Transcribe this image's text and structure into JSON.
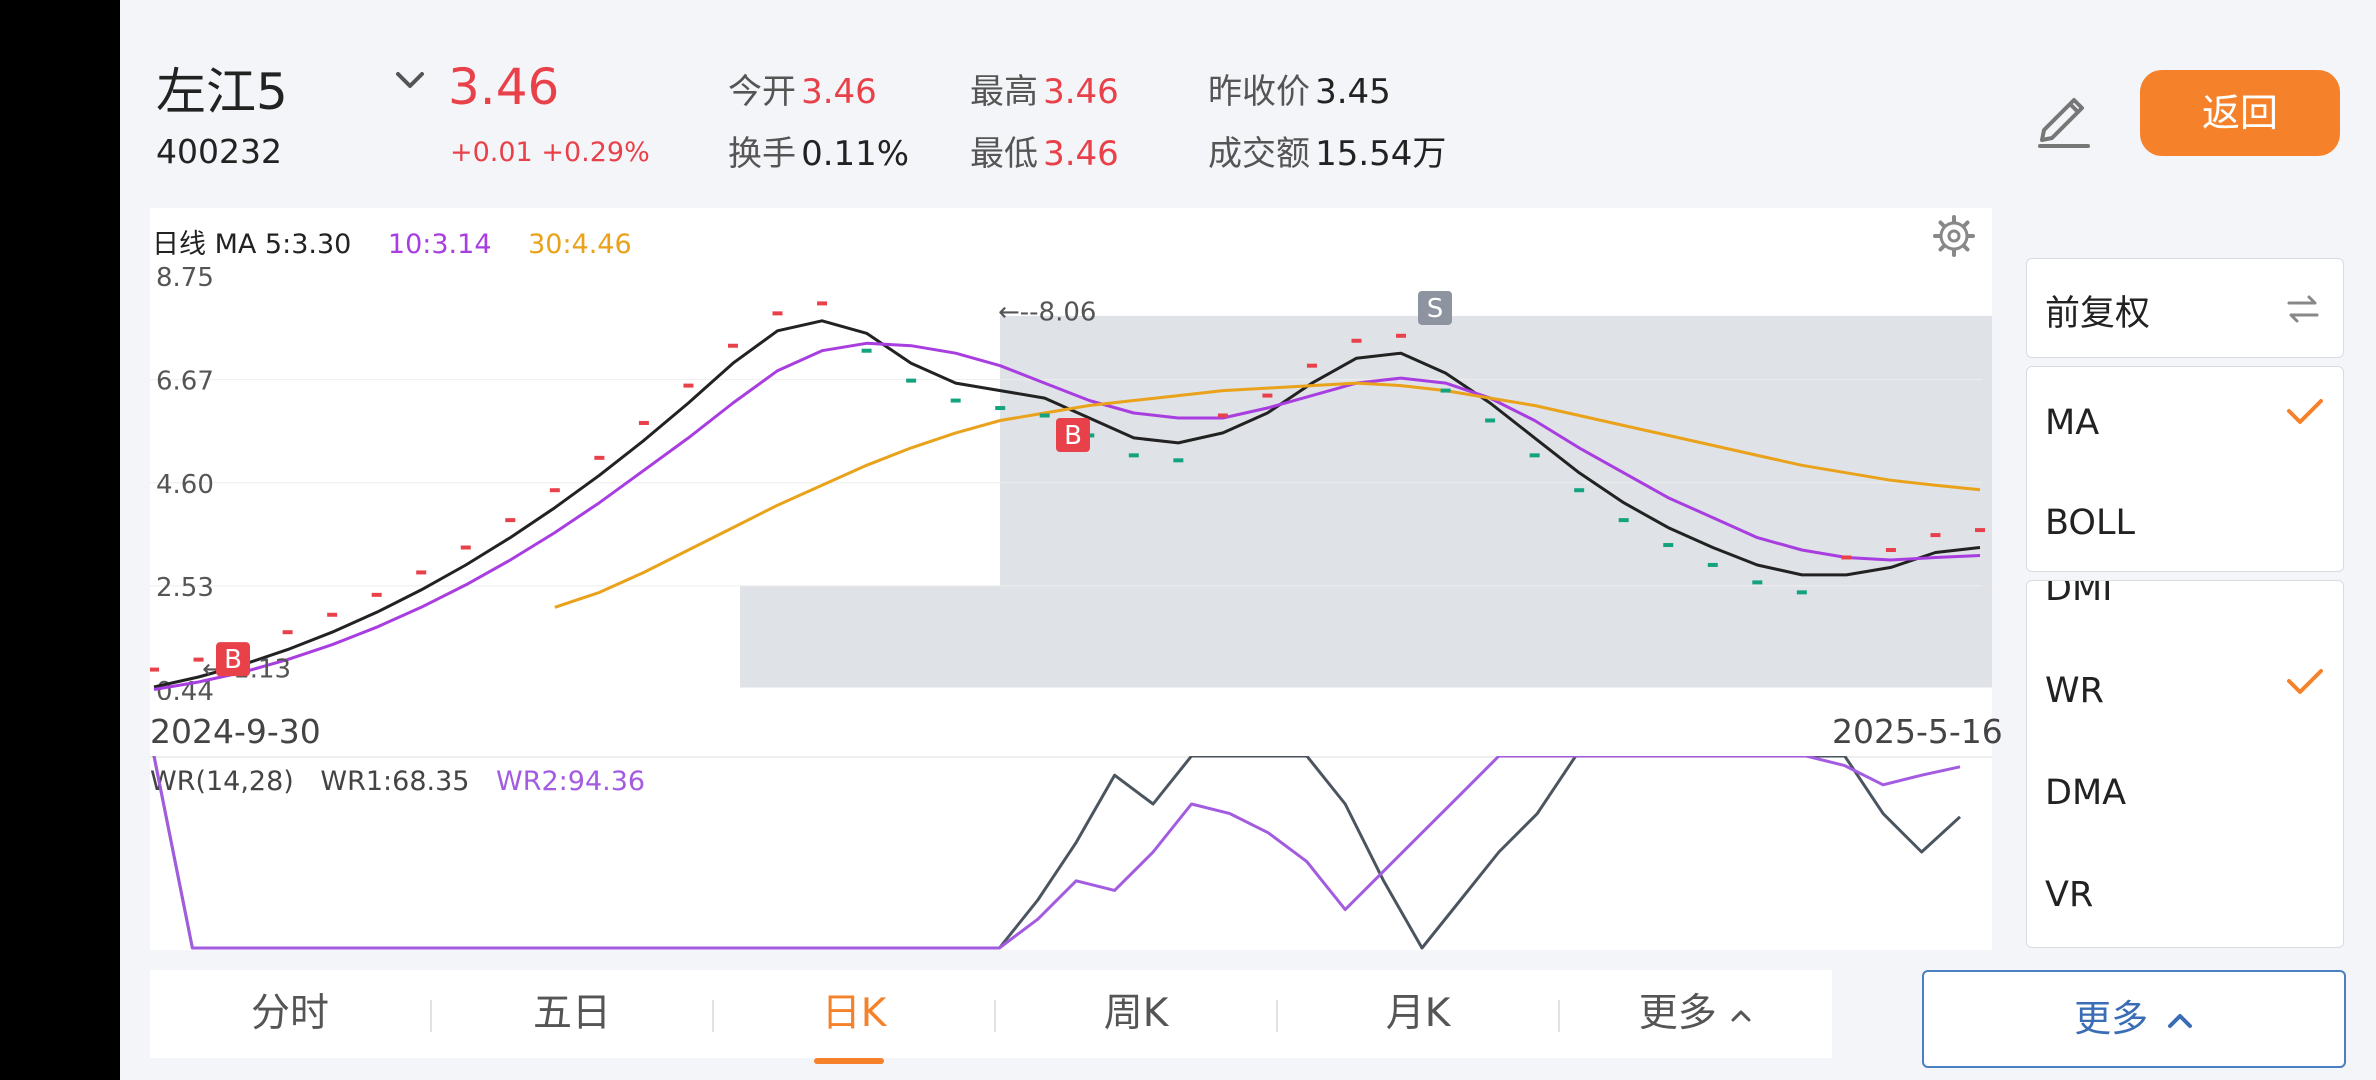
{
  "stock": {
    "name": "左江5",
    "code": "400232",
    "price": "3.46",
    "change": "+0.01 +0.29%"
  },
  "quote": {
    "open_label": "今开",
    "open_value": "3.46",
    "high_label": "最高",
    "high_value": "3.46",
    "prev_label": "昨收价",
    "prev_value": "3.45",
    "turnover_label": "换手",
    "turnover_value": "0.11%",
    "low_label": "最低",
    "low_value": "3.46",
    "amount_label": "成交额",
    "amount_value": "15.54万"
  },
  "actions": {
    "back_label": "返回"
  },
  "ma_legend": {
    "prefix": "日线 MA 5:3.30",
    "ma10": "10:3.14",
    "ma30": "30:4.46"
  },
  "colors": {
    "ma5": "#222222",
    "ma10": "#a83de0",
    "ma30": "#e9a21a",
    "up": "#e8414a",
    "down": "#14a37f",
    "accent": "#f5822a",
    "wr1": "#4a5560",
    "wr2": "#a35be0"
  },
  "chart_data": [
    {
      "type": "line",
      "title": "日线 MA",
      "y_ticks": [
        "8.75",
        "6.67",
        "4.60",
        "2.53",
        "0.44"
      ],
      "ylim": [
        0.44,
        8.75
      ],
      "x_range_labels": [
        "2024-9-30",
        "2025-5-16"
      ],
      "annotations": {
        "high": "←--8.06",
        "low": "←-1.13"
      },
      "markers": [
        {
          "label": "B",
          "at": "low"
        },
        {
          "label": "B",
          "at": "mid"
        },
        {
          "label": "S",
          "at": "high"
        }
      ],
      "series": [
        {
          "name": "5",
          "legend_value": "3.30",
          "values": [
            0.5,
            0.7,
            0.95,
            1.25,
            1.6,
            2.0,
            2.45,
            2.95,
            3.5,
            4.1,
            4.75,
            5.45,
            6.2,
            7.0,
            7.65,
            7.85,
            7.6,
            7.0,
            6.6,
            6.45,
            6.3,
            5.9,
            5.5,
            5.4,
            5.6,
            6.0,
            6.6,
            7.1,
            7.2,
            6.8,
            6.2,
            5.5,
            4.8,
            4.2,
            3.7,
            3.3,
            2.95,
            2.75,
            2.75,
            2.9,
            3.2,
            3.3
          ]
        },
        {
          "name": "10",
          "legend_value": "3.14",
          "values": [
            0.45,
            0.6,
            0.8,
            1.05,
            1.35,
            1.7,
            2.1,
            2.55,
            3.05,
            3.6,
            4.2,
            4.85,
            5.5,
            6.2,
            6.85,
            7.25,
            7.4,
            7.35,
            7.2,
            6.95,
            6.6,
            6.25,
            6.0,
            5.9,
            5.9,
            6.1,
            6.35,
            6.6,
            6.7,
            6.6,
            6.3,
            5.85,
            5.3,
            4.8,
            4.3,
            3.9,
            3.5,
            3.25,
            3.1,
            3.05,
            3.1,
            3.14
          ]
        },
        {
          "name": "30",
          "legend_value": "4.46",
          "values": [
            null,
            null,
            null,
            null,
            null,
            null,
            null,
            null,
            null,
            2.1,
            2.4,
            2.8,
            3.25,
            3.7,
            4.15,
            4.55,
            4.95,
            5.3,
            5.6,
            5.85,
            6.0,
            6.15,
            6.25,
            6.35,
            6.45,
            6.5,
            6.55,
            6.6,
            6.55,
            6.45,
            6.3,
            6.15,
            5.95,
            5.75,
            5.55,
            5.35,
            5.15,
            4.95,
            4.8,
            4.65,
            4.55,
            4.46
          ]
        }
      ]
    },
    {
      "type": "line",
      "title": "WR(14,28)",
      "ylim": [
        0,
        100
      ],
      "series": [
        {
          "name": "WR1",
          "legend_value": "68.35",
          "values": [
            100,
            0,
            0,
            0,
            0,
            0,
            0,
            0,
            0,
            0,
            0,
            0,
            0,
            0,
            0,
            0,
            0,
            0,
            0,
            0,
            0,
            0,
            0,
            25,
            55,
            90,
            75,
            100,
            100,
            100,
            100,
            75,
            35,
            0,
            25,
            50,
            70,
            100,
            100,
            100,
            100,
            100,
            100,
            100,
            100,
            70,
            50,
            68.35
          ]
        },
        {
          "name": "WR2",
          "legend_value": "94.36",
          "values": [
            100,
            0,
            0,
            0,
            0,
            0,
            0,
            0,
            0,
            0,
            0,
            0,
            0,
            0,
            0,
            0,
            0,
            0,
            0,
            0,
            0,
            0,
            0,
            15,
            35,
            30,
            50,
            75,
            70,
            60,
            45,
            20,
            40,
            60,
            80,
            100,
            100,
            100,
            100,
            100,
            100,
            100,
            100,
            100,
            95,
            85,
            90,
            94.36
          ]
        }
      ]
    }
  ],
  "wr_legend": {
    "title": "WR(14,28)",
    "wr1": "WR1:68.35",
    "wr2": "WR2:94.36"
  },
  "side_menu": {
    "adjust_label": "前复权",
    "main_items": [
      {
        "label": "MA",
        "checked": true
      },
      {
        "label": "BOLL",
        "checked": false
      }
    ],
    "sub_items": [
      {
        "label": "DMI",
        "checked": false
      },
      {
        "label": "WR",
        "checked": true
      },
      {
        "label": "DMA",
        "checked": false
      },
      {
        "label": "VR",
        "checked": false
      }
    ],
    "more_label": "更多"
  },
  "tabs": [
    {
      "label": "分时",
      "active": false
    },
    {
      "label": "五日",
      "active": false
    },
    {
      "label": "日K",
      "active": true
    },
    {
      "label": "周K",
      "active": false
    },
    {
      "label": "月K",
      "active": false
    },
    {
      "label": "更多",
      "active": false
    }
  ]
}
